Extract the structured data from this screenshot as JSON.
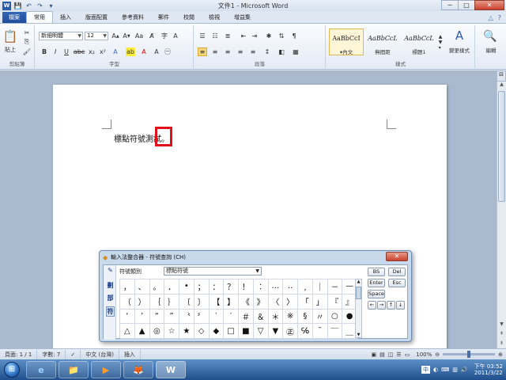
{
  "window": {
    "title": "文件1 - Microsoft Word",
    "qat_icons": [
      "word-icon",
      "save-icon",
      "undo-icon",
      "redo-icon",
      "qat-more-icon"
    ],
    "controls": {
      "minimize": "─",
      "maximize": "□",
      "close": "✕"
    }
  },
  "ribbon": {
    "tabs": [
      "檔案",
      "常用",
      "插入",
      "版面配置",
      "參考資料",
      "郵件",
      "校閱",
      "檢視",
      "增益集"
    ],
    "active_tab": "常用",
    "help_icon": "?",
    "clipboard": {
      "label": "剪貼簿",
      "paste": "貼上"
    },
    "font": {
      "label": "字型",
      "name": "新細明體",
      "size": "12"
    },
    "paragraph": {
      "label": "段落"
    },
    "styles": {
      "label": "樣式",
      "items": [
        {
          "sample": "AaBbCcI",
          "name": "▾內文"
        },
        {
          "sample": "AaBbCcL",
          "name": "無間距"
        },
        {
          "sample": "AaBbCcL",
          "name": "標題1"
        }
      ],
      "change_styles": "變更樣式"
    },
    "editing": {
      "label": "編輯"
    }
  },
  "document": {
    "text": "標點符號測試",
    "selected_char": "。",
    "highlight_color": "#e0101a"
  },
  "ime": {
    "title": "輸入法整合器 - 符號查詢 (CH)",
    "close": "✕",
    "category_label": "符號類別",
    "category_value": "標點符號",
    "left_tabs": [
      "劃",
      "部",
      "符"
    ],
    "symbols": [
      [
        "，",
        "、",
        "。",
        "．",
        "•",
        "；",
        "：",
        "？",
        "！",
        "︰",
        "…",
        "‥",
        "﹐",
        "｜",
        "－",
        "—"
      ],
      [
        "（",
        "）",
        "｛",
        "｝",
        "〔",
        "〕",
        "【",
        "】",
        "《",
        "》",
        "〈",
        "〉",
        "「",
        "」",
        "『",
        "』"
      ],
      [
        "‘",
        "’",
        "“",
        "”",
        "〝",
        "〞",
        "‵",
        "′",
        "＃",
        "＆",
        "＊",
        "※",
        "§",
        "〃",
        "○",
        "●"
      ],
      [
        "△",
        "▲",
        "◎",
        "☆",
        "★",
        "◇",
        "◆",
        "□",
        "■",
        "▽",
        "▼",
        "㊣",
        "℅",
        "¯",
        "￣",
        "＿"
      ]
    ],
    "buttons": {
      "bs": "BS",
      "del": "Del",
      "enter": "Enter",
      "esc": "Esc",
      "space": "Space"
    },
    "arrows": [
      "←",
      "→",
      "↑",
      "↓"
    ]
  },
  "statusbar": {
    "page": "頁面: 1 / 1",
    "words": "字數: 7",
    "language": "中文 (台灣)",
    "mode": "插入",
    "zoom": "100%"
  },
  "taskbar": {
    "apps": [
      "e",
      "📁",
      "▶",
      "🦊",
      "W"
    ],
    "ime_indicator": "中",
    "time": "下午 03:52",
    "date": "2011/3/22"
  }
}
